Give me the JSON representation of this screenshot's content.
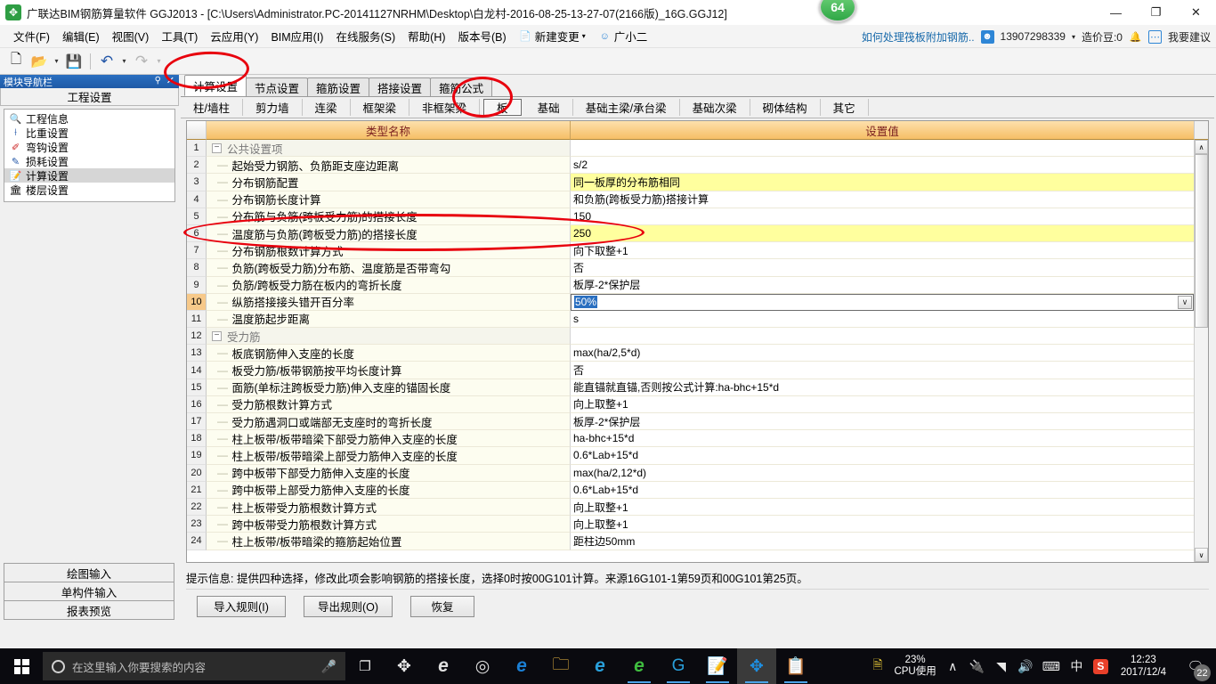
{
  "window": {
    "title": "广联达BIM钢筋算量软件 GGJ2013 - [C:\\Users\\Administrator.PC-20141127NRHM\\Desktop\\白龙村-2016-08-25-13-27-07(2166版)_16G.GGJ12]",
    "badge": "64",
    "minimize": "—",
    "maximize": "❐",
    "close": "✕"
  },
  "menubar": {
    "items": [
      "文件(F)",
      "编辑(E)",
      "视图(V)",
      "工具(T)",
      "云应用(Y)",
      "BIM应用(I)",
      "在线服务(S)",
      "帮助(H)",
      "版本号(B)"
    ],
    "new_change": "新建变更",
    "new_change_arrow": "▾",
    "assistant": "广小二",
    "right_link": "如何处理筏板附加钢筋..",
    "account": "13907298339",
    "account_arrow": "▾",
    "coins": "造价豆:0",
    "suggest": "我要建议"
  },
  "toolbar": {
    "new_icon": "🗋",
    "open_icon": "📂",
    "save_icon": "💾",
    "undo_icon": "↶",
    "redo_icon": "↷",
    "dropdown_arrow": "▾"
  },
  "leftdock": {
    "header": "模块导航栏",
    "pin": "⚲",
    "close": "✕",
    "group_title": "工程设置",
    "tree": [
      {
        "label": "工程信息",
        "icon": "🔍",
        "selected": false
      },
      {
        "label": "比重设置",
        "icon": "⟊",
        "selected": false
      },
      {
        "label": "弯钩设置",
        "icon": "✐",
        "selected": false
      },
      {
        "label": "损耗设置",
        "icon": "✎",
        "selected": false
      },
      {
        "label": "计算设置",
        "icon": "📝",
        "selected": true
      },
      {
        "label": "楼层设置",
        "icon": "🏛",
        "selected": false
      }
    ],
    "bottom_buttons": [
      "绘图输入",
      "单构件输入",
      "报表预览"
    ]
  },
  "tabs_primary": [
    {
      "label": "计算设置",
      "active": true
    },
    {
      "label": "节点设置",
      "active": false
    },
    {
      "label": "箍筋设置",
      "active": false
    },
    {
      "label": "搭接设置",
      "active": false
    },
    {
      "label": "箍筋公式",
      "active": false
    }
  ],
  "tabs_secondary": [
    {
      "label": "柱/墙柱",
      "active": false
    },
    {
      "label": "剪力墙",
      "active": false
    },
    {
      "label": "连梁",
      "active": false
    },
    {
      "label": "框架梁",
      "active": false
    },
    {
      "label": "非框架梁",
      "active": false
    },
    {
      "label": "板",
      "active": true
    },
    {
      "label": "基础",
      "active": false
    },
    {
      "label": "基础主梁/承台梁",
      "active": false
    },
    {
      "label": "基础次梁",
      "active": false
    },
    {
      "label": "砌体结构",
      "active": false
    },
    {
      "label": "其它",
      "active": false
    }
  ],
  "grid": {
    "columns": [
      "类型名称",
      "设置值"
    ],
    "expander_collapse": "−",
    "dropdown_arrow": "∨",
    "rows": [
      {
        "num": "1",
        "name": "公共设置项",
        "value": "",
        "group": true,
        "highlight": false
      },
      {
        "num": "2",
        "name": "起始受力钢筋、负筋距支座边距离",
        "value": "s/2",
        "group": false,
        "highlight": false
      },
      {
        "num": "3",
        "name": "分布钢筋配置",
        "value": "同一板厚的分布筋相同",
        "group": false,
        "highlight": true
      },
      {
        "num": "4",
        "name": "分布钢筋长度计算",
        "value": "和负筋(跨板受力筋)搭接计算",
        "group": false,
        "highlight": false
      },
      {
        "num": "5",
        "name": "分布筋与负筋(跨板受力筋)的搭接长度",
        "value": "150",
        "group": false,
        "highlight": false
      },
      {
        "num": "6",
        "name": "温度筋与负筋(跨板受力筋)的搭接长度",
        "value": "250",
        "group": false,
        "highlight": true
      },
      {
        "num": "7",
        "name": "分布钢筋根数计算方式",
        "value": "向下取整+1",
        "group": false,
        "highlight": false
      },
      {
        "num": "8",
        "name": "负筋(跨板受力筋)分布筋、温度筋是否带弯勾",
        "value": "否",
        "group": false,
        "highlight": false
      },
      {
        "num": "9",
        "name": "负筋/跨板受力筋在板内的弯折长度",
        "value": "板厚-2*保护层",
        "group": false,
        "highlight": false
      },
      {
        "num": "10",
        "name": "纵筋搭接接头错开百分率",
        "value": "50%",
        "group": false,
        "highlight": false,
        "editing": true
      },
      {
        "num": "11",
        "name": "温度筋起步距离",
        "value": "s",
        "group": false,
        "highlight": false
      },
      {
        "num": "12",
        "name": "受力筋",
        "value": "",
        "group": true,
        "highlight": false
      },
      {
        "num": "13",
        "name": "板底钢筋伸入支座的长度",
        "value": "max(ha/2,5*d)",
        "group": false,
        "highlight": false
      },
      {
        "num": "14",
        "name": "板受力筋/板带钢筋按平均长度计算",
        "value": "否",
        "group": false,
        "highlight": false
      },
      {
        "num": "15",
        "name": "面筋(单标注跨板受力筋)伸入支座的锚固长度",
        "value": "能直锚就直锚,否则按公式计算:ha-bhc+15*d",
        "group": false,
        "highlight": false
      },
      {
        "num": "16",
        "name": "受力筋根数计算方式",
        "value": "向上取整+1",
        "group": false,
        "highlight": false
      },
      {
        "num": "17",
        "name": "受力筋遇洞口或端部无支座时的弯折长度",
        "value": "板厚-2*保护层",
        "group": false,
        "highlight": false
      },
      {
        "num": "18",
        "name": "柱上板带/板带暗梁下部受力筋伸入支座的长度",
        "value": "ha-bhc+15*d",
        "group": false,
        "highlight": false
      },
      {
        "num": "19",
        "name": "柱上板带/板带暗梁上部受力筋伸入支座的长度",
        "value": "0.6*Lab+15*d",
        "group": false,
        "highlight": false
      },
      {
        "num": "20",
        "name": "跨中板带下部受力筋伸入支座的长度",
        "value": "max(ha/2,12*d)",
        "group": false,
        "highlight": false
      },
      {
        "num": "21",
        "name": "跨中板带上部受力筋伸入支座的长度",
        "value": "0.6*Lab+15*d",
        "group": false,
        "highlight": false
      },
      {
        "num": "22",
        "name": "柱上板带受力筋根数计算方式",
        "value": "向上取整+1",
        "group": false,
        "highlight": false
      },
      {
        "num": "23",
        "name": "跨中板带受力筋根数计算方式",
        "value": "向上取整+1",
        "group": false,
        "highlight": false
      },
      {
        "num": "24",
        "name": "柱上板带/板带暗梁的箍筋起始位置",
        "value": "距柱边50mm",
        "group": false,
        "highlight": false
      }
    ],
    "scroll_up": "∧",
    "scroll_down": "∨"
  },
  "hint": "提示信息: 提供四种选择，修改此项会影响钢筋的搭接长度，选择0时按00G101计算。来源16G101-1第59页和00G101第25页。",
  "footer_buttons": [
    "导入规则(I)",
    "导出规则(O)",
    "恢复"
  ],
  "taskbar": {
    "search_placeholder": "在这里输入你要搜索的内容",
    "mic_icon": "🎤",
    "taskview_icon": "❐",
    "cpu_percent": "23%",
    "cpu_label": "CPU使用",
    "tray_chevron": "∧",
    "battery_icon": "🔌",
    "wifi_icon": "◥",
    "volume_icon": "🔊",
    "keyboard_icon": "⌨",
    "ime_icon": "中",
    "sogou_icon": "S",
    "time": "12:23",
    "date": "2017/12/4",
    "notif_count": "22",
    "apps": [
      {
        "name": "app-propeller",
        "glyph": "✥",
        "color": "#e8e8e8",
        "running": false,
        "active": false
      },
      {
        "name": "app-edge-dev",
        "glyph": "e",
        "color": "#e0e0e0",
        "running": false,
        "active": false
      },
      {
        "name": "app-globe-bell",
        "glyph": "◎",
        "color": "#dedede",
        "running": false,
        "active": false
      },
      {
        "name": "app-edge",
        "glyph": "e",
        "color": "#1b7fd4",
        "running": false,
        "active": false
      },
      {
        "name": "app-explorer",
        "glyph": "🗀",
        "color": "#f5c044",
        "running": false,
        "active": false
      },
      {
        "name": "app-internet-explorer",
        "glyph": "e",
        "color": "#29a0db",
        "running": false,
        "active": false
      },
      {
        "name": "app-360-browser",
        "glyph": "e",
        "color": "#3fbd3f",
        "running": true,
        "active": false
      },
      {
        "name": "app-gg-browser",
        "glyph": "G",
        "color": "#29a0db",
        "running": true,
        "active": false
      },
      {
        "name": "app-notepad-edit",
        "glyph": "📝",
        "color": "#e8832a",
        "running": true,
        "active": false
      },
      {
        "name": "app-glodon-ggj",
        "glyph": "✥",
        "color": "#1e8ee0",
        "running": true,
        "active": true
      },
      {
        "name": "app-docs",
        "glyph": "📋",
        "color": "#f0f0f0",
        "running": true,
        "active": false
      }
    ]
  },
  "annotations": {
    "ellipse_tab_note": "计算设置",
    "ellipse_plate_note": "板",
    "ellipse_row_note": "温度筋与负筋(跨板受力筋)的搭接长度"
  }
}
